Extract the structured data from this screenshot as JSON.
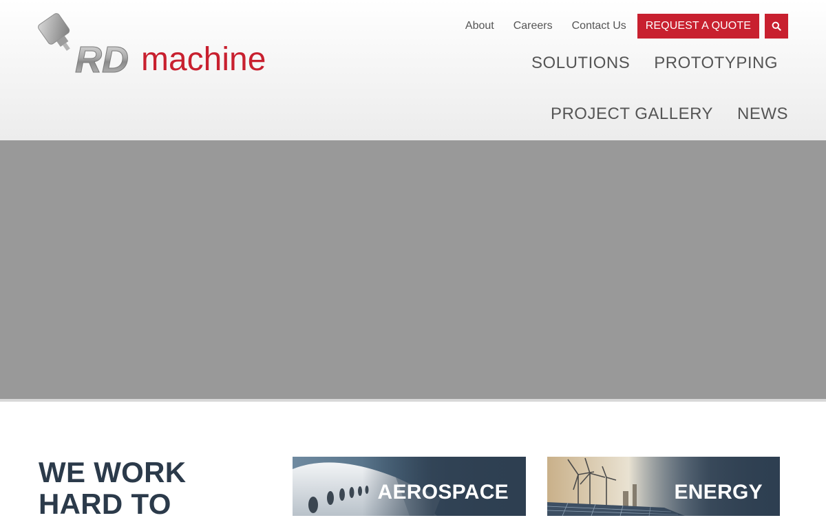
{
  "logo": {
    "brand_rd": "RD",
    "brand_machine": "machine"
  },
  "utility_nav": {
    "about": "About",
    "careers": "Careers",
    "contact": "Contact Us",
    "quote_button": "REQUEST A QUOTE",
    "search_icon": "search-icon"
  },
  "main_nav": {
    "items": [
      "SOLUTIONS",
      "PROTOTYPING",
      "PROJECT GALLERY",
      "NEWS"
    ]
  },
  "intro": {
    "heading_line1": "WE WORK",
    "heading_line2": "HARD TO"
  },
  "industries": [
    {
      "title": "AEROSPACE",
      "image": "airplane-photo"
    },
    {
      "title": "ENERGY",
      "image": "wind-turbines-solar-photo"
    }
  ],
  "colors": {
    "accent": "#c8202f",
    "nav_text": "#555555",
    "heading": "#2b3a4a",
    "hero_placeholder": "#999999",
    "card_overlay": "#2e3f51"
  }
}
